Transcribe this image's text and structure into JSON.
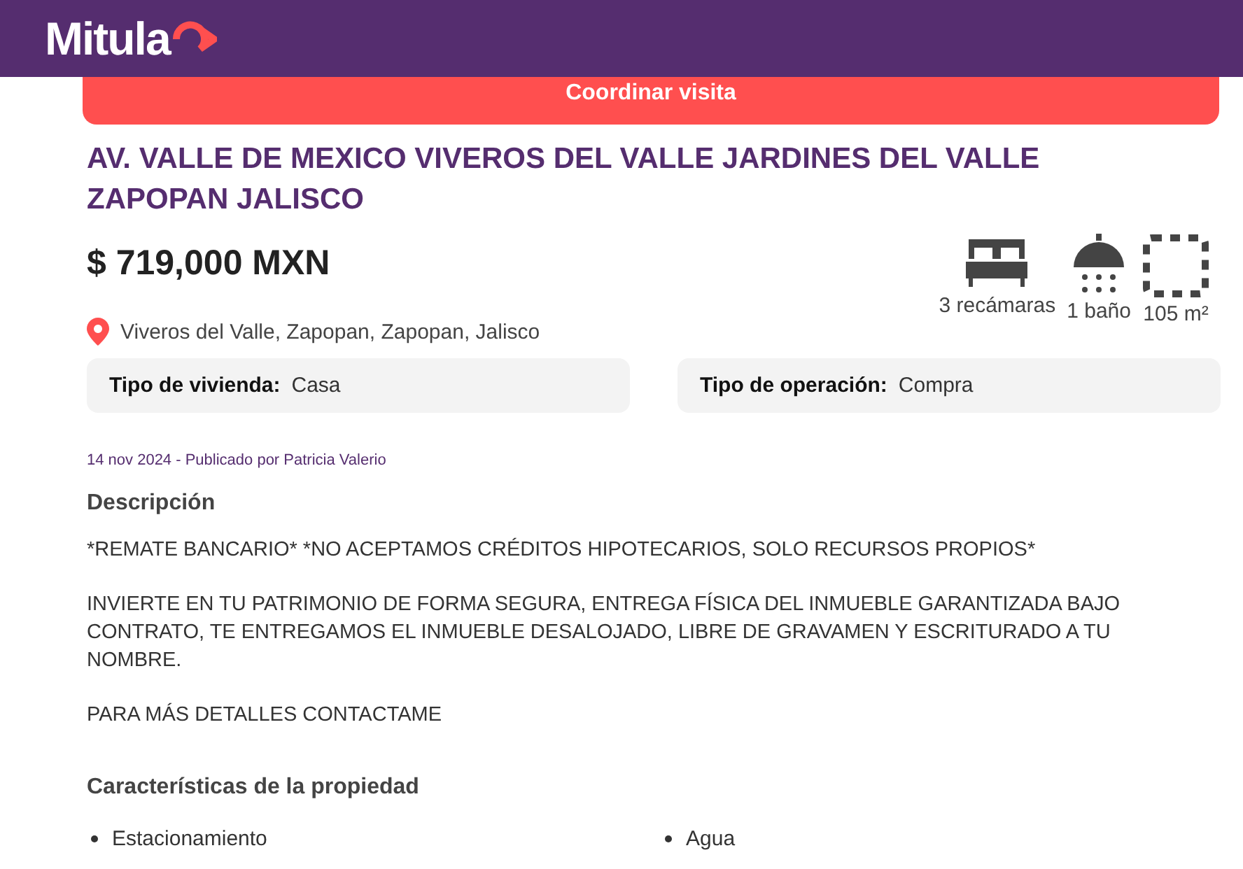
{
  "header": {
    "logo": "Mitula"
  },
  "cta_button": "Coordinar visita",
  "listing": {
    "title": "AV. VALLE DE MEXICO VIVEROS DEL VALLE JARDINES DEL VALLE ZAPOPAN JALISCO",
    "price": "$ 719,000 MXN",
    "features": [
      {
        "kind": "bed",
        "label": "3 recámaras"
      },
      {
        "kind": "shower",
        "label": "1 baño"
      },
      {
        "kind": "area",
        "label": "105 m²"
      }
    ],
    "location": "Viveros del Valle, Zapopan, Zapopan, Jalisco",
    "attributes": [
      {
        "label": "Tipo de vivienda:",
        "value": "Casa"
      },
      {
        "label": "Tipo de operación:",
        "value": "Compra"
      }
    ],
    "published": "14 nov 2024 - Publicado por Patricia Valerio"
  },
  "description": {
    "heading": "Descripción",
    "paragraphs": [
      "*REMATE BANCARIO* *NO ACEPTAMOS CRÉDITOS HIPOTECARIOS, SOLO RECURSOS PROPIOS*",
      "INVIERTE EN TU PATRIMONIO DE FORMA SEGURA, ENTREGA FÍSICA DEL INMUEBLE GARANTIZADA BAJO CONTRATO, TE ENTREGAMOS EL INMUEBLE DESALOJADO, LIBRE DE GRAVAMEN Y ESCRITURADO A TU NOMBRE.",
      "PARA MÁS DETALLES CONTACTAME"
    ]
  },
  "characteristics": {
    "heading": "Características de la propiedad",
    "items": [
      "Estacionamiento",
      "Agua"
    ]
  }
}
